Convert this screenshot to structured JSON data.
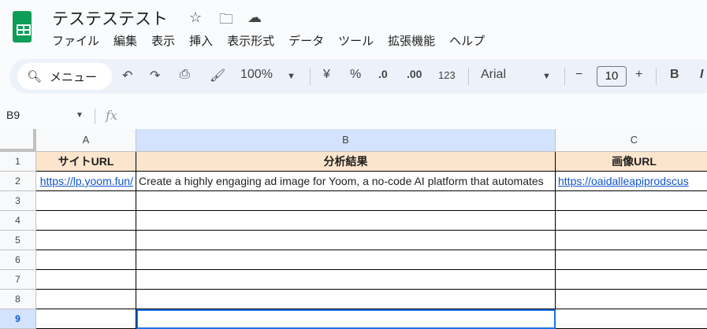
{
  "doc": {
    "title": "テステステスト"
  },
  "menu": [
    "ファイル",
    "編集",
    "表示",
    "挿入",
    "表示形式",
    "データ",
    "ツール",
    "拡張機能",
    "ヘルプ"
  ],
  "toolbar": {
    "search": "メニュー",
    "zoom": "100%",
    "currency": "¥",
    "percent": "%",
    "dec_decrease": ".0",
    "dec_increase": ".00",
    "format": "123",
    "font": "Arial",
    "font_size": "10",
    "minus": "−",
    "plus": "+",
    "bold": "B",
    "italic": "I"
  },
  "formula_bar": {
    "name_box": "B9",
    "fx": "fx"
  },
  "columns": [
    "A",
    "B",
    "C"
  ],
  "rows": [
    "1",
    "2",
    "3",
    "4",
    "5",
    "6",
    "7",
    "8",
    "9"
  ],
  "cells": {
    "a1": "サイトURL",
    "b1": "分析結果",
    "c1": "画像URL",
    "a2": "https://lp.yoom.fun/",
    "b2": "Create a highly engaging ad image for Yoom, a no-code AI platform that automates",
    "c2": "https://oaidalleapiprodscus"
  }
}
